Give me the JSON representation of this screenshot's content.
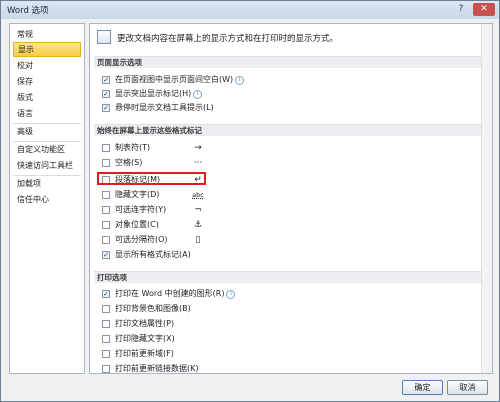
{
  "window": {
    "title": "Word 选项",
    "help": "?",
    "close": "✕"
  },
  "sidebar": {
    "items": [
      {
        "label": "常规",
        "active": false
      },
      {
        "label": "显示",
        "active": true
      },
      {
        "label": "校对",
        "active": false
      },
      {
        "label": "保存",
        "active": false
      },
      {
        "label": "版式",
        "active": false
      },
      {
        "label": "语言",
        "active": false
      },
      {
        "label": "高级",
        "active": false
      },
      {
        "label": "自定义功能区",
        "active": false
      },
      {
        "label": "快速访问工具栏",
        "active": false
      },
      {
        "label": "加载项",
        "active": false
      },
      {
        "label": "信任中心",
        "active": false
      }
    ]
  },
  "intro": {
    "text": "更改文档内容在屏幕上的显示方式和在打印时的显示方式。"
  },
  "sections": {
    "page_display": {
      "title": "页面显示选项",
      "options": [
        {
          "label": "在页面视图中显示页面间空白(W)",
          "checked": true,
          "info": "i"
        },
        {
          "label": "显示突出显示标记(H)",
          "checked": true,
          "info": "i"
        },
        {
          "label": "悬停时显示文档工具提示(L)",
          "checked": true
        }
      ]
    },
    "formatting_marks": {
      "title": "始终在屏幕上显示这些格式标记",
      "options": [
        {
          "label": "制表符(T)",
          "checked": false,
          "symbol": "→"
        },
        {
          "label": "空格(S)",
          "checked": false,
          "symbol": "···"
        },
        {
          "label": "段落标记(M)",
          "checked": false,
          "symbol": "↵"
        },
        {
          "label": "隐藏文字(D)",
          "checked": false,
          "symbol": "abc"
        },
        {
          "label": "可选连字符(Y)",
          "checked": false,
          "symbol": "¬"
        },
        {
          "label": "对象位置(C)",
          "checked": false,
          "symbol": "⚓"
        },
        {
          "label": "可选分隔符(O)",
          "checked": false,
          "symbol": "▯"
        },
        {
          "label": "显示所有格式标记(A)",
          "checked": true
        }
      ]
    },
    "print": {
      "title": "打印选项",
      "options": [
        {
          "label": "打印在 Word 中创建的图形(R)",
          "checked": true,
          "info": "i"
        },
        {
          "label": "打印背景色和图像(B)",
          "checked": false
        },
        {
          "label": "打印文档属性(P)",
          "checked": false
        },
        {
          "label": "打印隐藏文字(X)",
          "checked": false
        },
        {
          "label": "打印前更新域(F)",
          "checked": false
        },
        {
          "label": "打印前更新链接数据(K)",
          "checked": false
        }
      ]
    }
  },
  "check_mark": "✓",
  "buttons": {
    "ok": "确定",
    "cancel": "取消"
  },
  "colors": {
    "highlight": "#e51b1b",
    "active_nav": "#f9cc47"
  }
}
